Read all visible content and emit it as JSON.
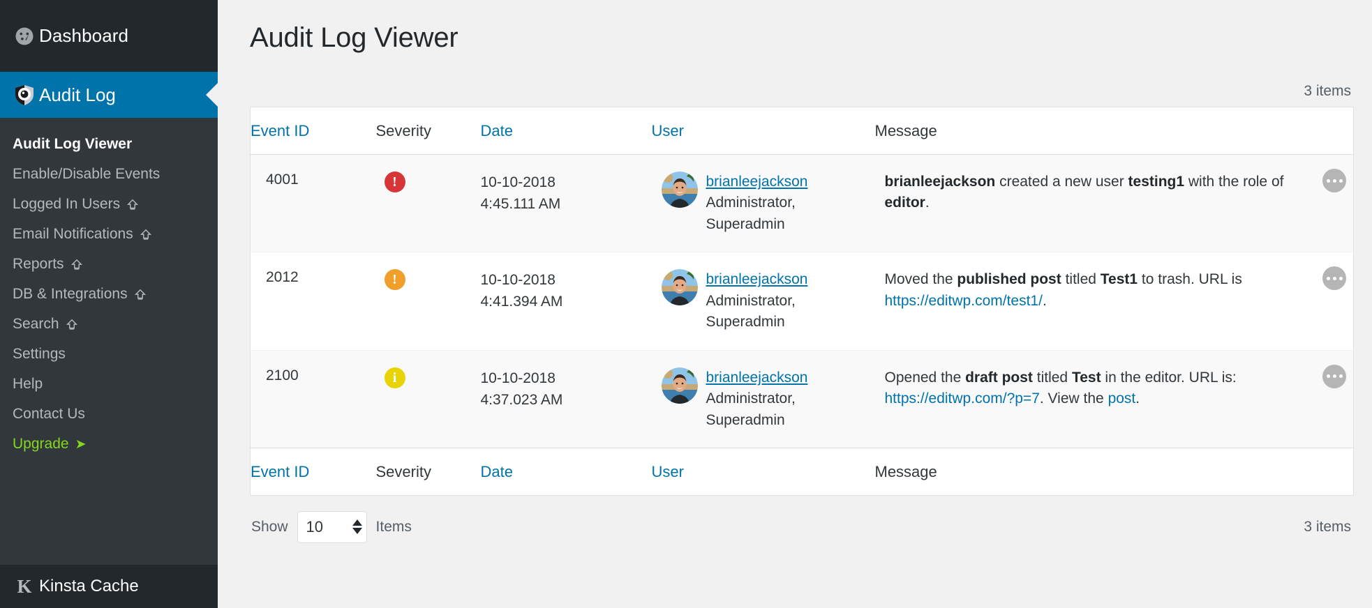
{
  "sidebar": {
    "dashboard": {
      "label": "Dashboard",
      "icon": "dashboard-icon"
    },
    "active_menu": {
      "label": "Audit Log",
      "icon": "shield-eye-icon"
    },
    "submenu": [
      {
        "label": "Audit Log Viewer",
        "current": true,
        "badge": ""
      },
      {
        "label": "Enable/Disable Events",
        "current": false,
        "badge": ""
      },
      {
        "label": "Logged In Users",
        "current": false,
        "badge": "crown-icon"
      },
      {
        "label": "Email Notifications",
        "current": false,
        "badge": "crown-icon"
      },
      {
        "label": "Reports",
        "current": false,
        "badge": "crown-icon"
      },
      {
        "label": "DB & Integrations",
        "current": false,
        "badge": "crown-icon"
      },
      {
        "label": "Search",
        "current": false,
        "badge": "crown-icon"
      },
      {
        "label": "Settings",
        "current": false,
        "badge": ""
      },
      {
        "label": "Help",
        "current": false,
        "badge": ""
      },
      {
        "label": "Contact Us",
        "current": false,
        "badge": ""
      },
      {
        "label": "Upgrade",
        "current": false,
        "badge": "arrow-right-icon",
        "upgrade": true
      }
    ],
    "bottom": {
      "label": "Kinsta Cache",
      "icon": "kinsta-k-icon"
    }
  },
  "header": {
    "page_title": "Audit Log Viewer",
    "items_count_top": "3 items",
    "items_count_bottom": "3 items"
  },
  "table": {
    "columns": [
      {
        "key": "event_id",
        "label": "Event ID",
        "sortable": true
      },
      {
        "key": "severity",
        "label": "Severity",
        "sortable": false
      },
      {
        "key": "date",
        "label": "Date",
        "sortable": true
      },
      {
        "key": "user",
        "label": "User",
        "sortable": true
      },
      {
        "key": "message",
        "label": "Message",
        "sortable": false
      }
    ],
    "rows": [
      {
        "event_id": "4001",
        "severity": {
          "level": "critical",
          "glyph": "!",
          "color": "#d63638",
          "icon": "alert-critical-icon"
        },
        "date_day": "10-10-2018",
        "date_time": "4:45.111 AM",
        "user_name": "brianleejackson",
        "user_roles": "Administrator, Superadmin",
        "message_html": "<b>brianleejackson</b> created a new user <b>testing1</b> with the role of <b>editor</b>."
      },
      {
        "event_id": "2012",
        "severity": {
          "level": "warning",
          "glyph": "!",
          "color": "#f0a02a",
          "icon": "alert-warning-icon"
        },
        "date_day": "10-10-2018",
        "date_time": "4:41.394 AM",
        "user_name": "brianleejackson",
        "user_roles": "Administrator, Superadmin",
        "message_html": "Moved the <b>published post</b> titled <b>Test1</b> to trash. URL is <a href=\"#\">https://editwp.com/test1/</a>."
      },
      {
        "event_id": "2100",
        "severity": {
          "level": "notice",
          "glyph": "i",
          "color": "#e8d406",
          "icon": "alert-info-icon"
        },
        "date_day": "10-10-2018",
        "date_time": "4:37.023 AM",
        "user_name": "brianleejackson",
        "user_roles": "Administrator, Superadmin",
        "message_html": "Opened the <b>draft post</b> titled <b>Test</b> in the editor. URL is: <a href=\"#\">https://editwp.com/?p=7</a>. View the <a href=\"#\">post</a>."
      }
    ],
    "row_action_icon": "more-options-icon"
  },
  "tablenav": {
    "show_label": "Show",
    "per_page_value": "10",
    "items_label": "Items"
  },
  "colors": {
    "wp_blue": "#0073aa",
    "sidebar_bg": "#32373c",
    "sidebar_dark": "#23282d",
    "upgrade_green": "#83d71e",
    "link_blue": "#0073aa"
  }
}
